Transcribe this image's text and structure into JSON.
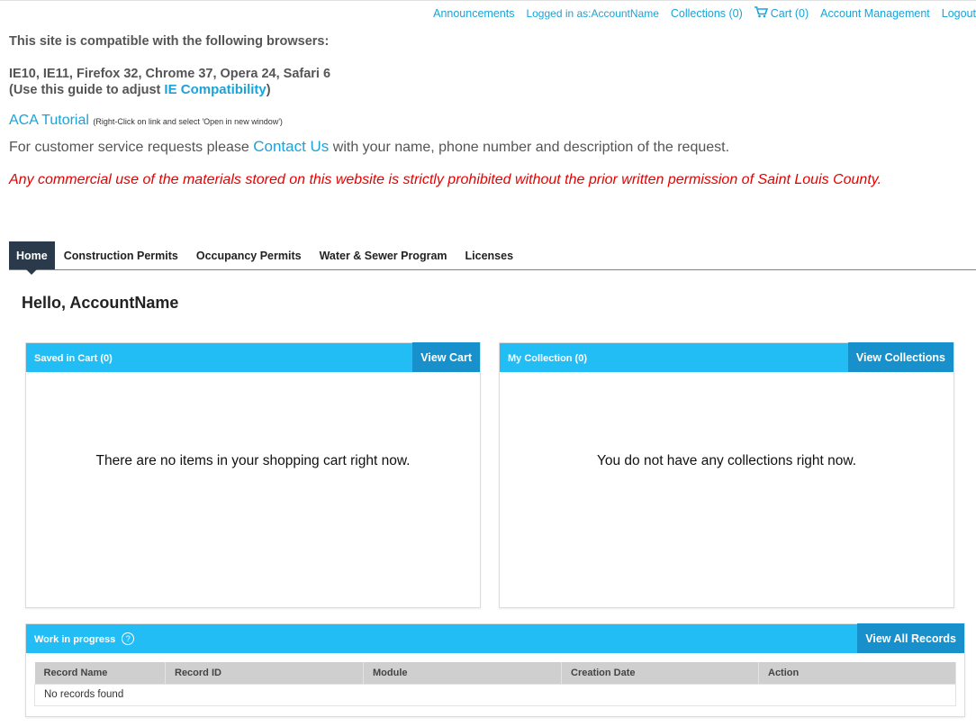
{
  "topnav": {
    "announcements": "Announcements",
    "logged_in": "Logged in as:AccountName",
    "collections": "Collections (0)",
    "cart": "Cart (0)",
    "account_management": "Account Management",
    "logout": "Logout"
  },
  "notice": {
    "compat_heading": "This site is compatible with the following browsers:",
    "browsers": "IE10, IE11, Firefox 32, Chrome 37, Opera 24, Safari 6",
    "guide_prefix": "(Use this guide to adjust ",
    "guide_link": "IE Compatibility",
    "guide_suffix": ")",
    "tutorial_link": "ACA Tutorial",
    "tutorial_hint": "(Right-Click on link and select 'Open in new window')",
    "service_prefix": "For customer service requests please ",
    "contact_link": "Contact Us",
    "service_suffix": " with your name, phone number and description of the request.",
    "warning": "Any commercial use of the materials stored on this website is strictly prohibited without the prior written permission of Saint Louis County."
  },
  "tabs": [
    {
      "label": "Home",
      "active": true
    },
    {
      "label": "Construction Permits"
    },
    {
      "label": "Occupancy Permits"
    },
    {
      "label": "Water & Sewer Program"
    },
    {
      "label": "Licenses"
    }
  ],
  "greeting": "Hello, AccountName",
  "cart_panel": {
    "title": "Saved in Cart (0)",
    "button": "View Cart",
    "empty": "There are no items in your shopping cart right now."
  },
  "collection_panel": {
    "title": "My Collection (0)",
    "button": "View Collections",
    "empty": "You do not have any collections right now."
  },
  "work_panel": {
    "title": "Work in progress",
    "help": "?",
    "button": "View All Records",
    "columns": [
      "Record Name",
      "Record ID",
      "Module",
      "Creation Date",
      "Action"
    ],
    "empty": "No records found"
  },
  "colors": {
    "accent": "#23bdf5",
    "button": "#1790cc",
    "link": "#1aa3d9",
    "warning": "#e60000",
    "active_tab": "#2b3a4a"
  }
}
